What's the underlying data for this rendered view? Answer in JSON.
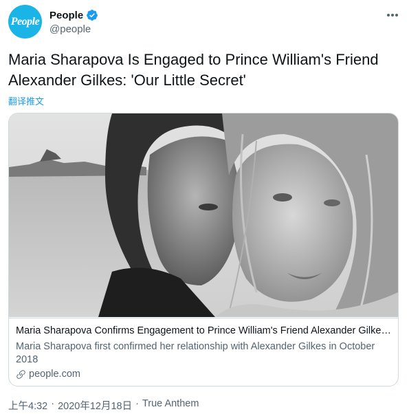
{
  "account": {
    "display_name": "People",
    "handle": "@people",
    "avatar_text": "People",
    "verified_icon": "verified-badge-icon",
    "brand_color": "#1ab5e6"
  },
  "tweet": {
    "text": "Maria Sharapova Is Engaged to Prince William's Friend Alexander Gilkes: 'Our Little Secret'",
    "translate_label": "翻译推文"
  },
  "card": {
    "image_desc": "photo",
    "title": "Maria Sharapova Confirms Engagement to Prince William's Friend Alexander Gilkes: 'Our Little Secret'",
    "description": "Maria Sharapova first confirmed her relationship with Alexander Gilkes in October 2018",
    "domain": "people.com",
    "link_icon": "link-icon"
  },
  "meta": {
    "time": "上午4:32",
    "separator1": "·",
    "date": "2020年12月18日",
    "separator2": "·",
    "source": "True Anthem"
  },
  "colors": {
    "text_primary": "#0f1419",
    "text_secondary": "#536471",
    "link": "#1d9bf0",
    "border": "#cfd9de"
  }
}
